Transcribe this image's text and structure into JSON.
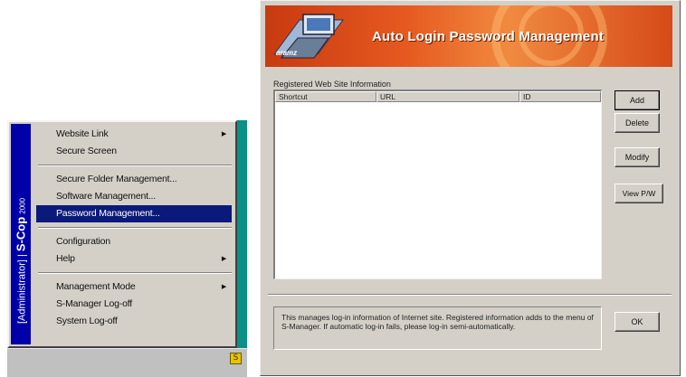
{
  "menu": {
    "side_label": "[Administrator]",
    "brand": "S-Cop",
    "version": "2000",
    "groups": [
      [
        {
          "label": "Website Link",
          "submenu": true
        },
        {
          "label": "Secure Screen",
          "submenu": false
        }
      ],
      [
        {
          "label": "Secure Folder Management...",
          "submenu": false
        },
        {
          "label": "Software Management...",
          "submenu": false
        },
        {
          "label": "Password Management...",
          "submenu": false,
          "selected": true
        }
      ],
      [
        {
          "label": "Configuration",
          "submenu": false
        },
        {
          "label": "Help",
          "submenu": true
        }
      ],
      [
        {
          "label": "Management Mode",
          "submenu": true
        },
        {
          "label": "S-Manager Log-off",
          "submenu": false
        },
        {
          "label": "System Log-off",
          "submenu": false
        }
      ]
    ],
    "submenu_arrow": "▶"
  },
  "tray": {
    "icon": "s-cop-tray-icon",
    "glyph": "S"
  },
  "dialog": {
    "banner_title": "Auto Login Password Management",
    "banner_brand": "aramz",
    "group_label": "Registered Web Site Information",
    "columns": [
      "Shortcut",
      "URL",
      "ID"
    ],
    "rows": [],
    "buttons": {
      "add": "Add",
      "delete": "Delete",
      "modify": "Modify",
      "view": "View P/W",
      "ok": "OK"
    },
    "info_text": "This manages log-in information of Internet site. Registered information adds to the menu of S-Manager. If automatic log-in fails, please log-in semi-automatically."
  },
  "colors": {
    "menu_sidebar": "#0000a8",
    "selection": "#0a1a7a",
    "banner": "#e65a20",
    "desktop": "#0b8f86"
  }
}
